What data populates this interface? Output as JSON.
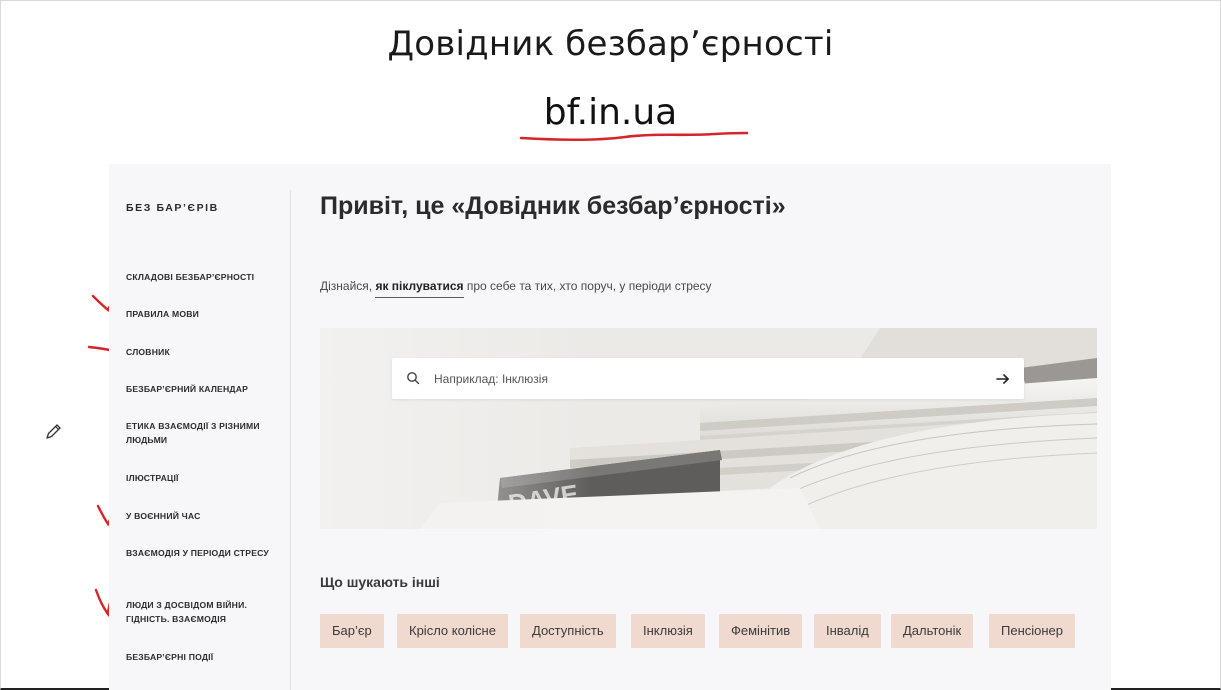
{
  "slide": {
    "title": "Довідник безбар’єрності",
    "url": "bf.in.ua"
  },
  "sidebar": {
    "brand": "БЕЗ БАР’ЄРІВ",
    "items": [
      {
        "label": "СКЛАДОВІ БЕЗБАР’ЄРНОСТІ"
      },
      {
        "label": "ПРАВИЛА МОВИ"
      },
      {
        "label": "СЛОВНИК"
      },
      {
        "label": "БЕЗБАР’ЄРНИЙ КАЛЕНДАР"
      },
      {
        "label": "ЕТИКА ВЗАЄМОДІЇ З РІЗНИМИ ЛЮДЬМИ"
      },
      {
        "label": "ІЛЮСТРАЦІЇ"
      },
      {
        "label": "У ВОЄННИЙ ЧАС"
      },
      {
        "label": "ВЗАЄМОДІЯ У ПЕРІОДИ СТРЕСУ"
      },
      {
        "label": "ЛЮДИ З ДОСВІДОМ ВІЙНИ. ГІДНІСТЬ. ВЗАЄМОДІЯ"
      },
      {
        "label": "БЕЗБАР’ЄРНІ ПОДІЇ"
      }
    ]
  },
  "main": {
    "title": "Привіт, це «Довідник безбар’єрності»",
    "intro": {
      "before": "Дізнайся, ",
      "link": "як піклуватися",
      "after": " про себе та тих, хто поруч, у періоди стресу"
    },
    "search": {
      "placeholder": "Наприклад: Інклюзія",
      "value": ""
    },
    "popular_title": "Що шукають інші",
    "tags": [
      {
        "label": "Бар’єр"
      },
      {
        "label": "Крісло колісне"
      },
      {
        "label": "Доступність"
      },
      {
        "label": "Інклюзія"
      },
      {
        "label": "Фемінітив"
      },
      {
        "label": "Інвалід"
      },
      {
        "label": "Дальтонік"
      },
      {
        "label": "Пенсіонер"
      }
    ]
  },
  "colors": {
    "tag_bg": "#f0d9ce",
    "annotation_red": "#d4262a",
    "site_bg": "#f7f6f8"
  }
}
